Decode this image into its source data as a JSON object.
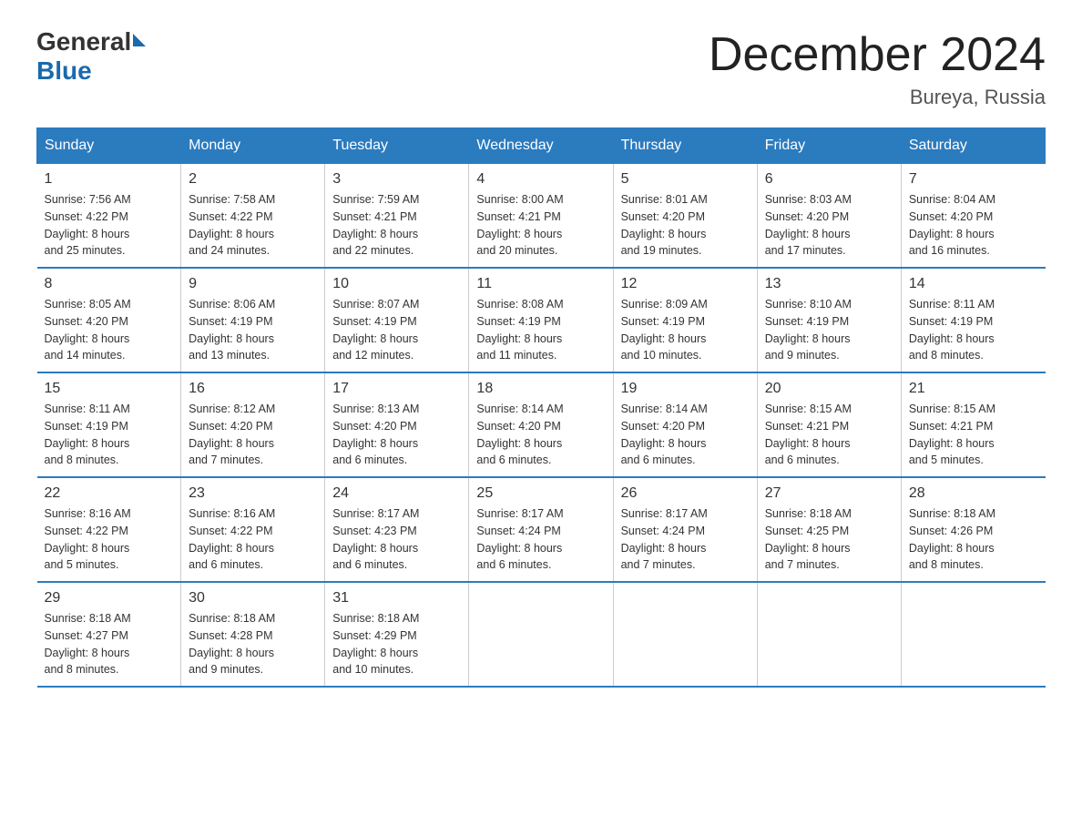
{
  "header": {
    "logo_general": "General",
    "logo_blue": "Blue",
    "month_title": "December 2024",
    "location": "Bureya, Russia"
  },
  "days_of_week": [
    "Sunday",
    "Monday",
    "Tuesday",
    "Wednesday",
    "Thursday",
    "Friday",
    "Saturday"
  ],
  "weeks": [
    [
      {
        "day": "1",
        "sunrise": "7:56 AM",
        "sunset": "4:22 PM",
        "daylight": "8 hours and 25 minutes."
      },
      {
        "day": "2",
        "sunrise": "7:58 AM",
        "sunset": "4:22 PM",
        "daylight": "8 hours and 24 minutes."
      },
      {
        "day": "3",
        "sunrise": "7:59 AM",
        "sunset": "4:21 PM",
        "daylight": "8 hours and 22 minutes."
      },
      {
        "day": "4",
        "sunrise": "8:00 AM",
        "sunset": "4:21 PM",
        "daylight": "8 hours and 20 minutes."
      },
      {
        "day": "5",
        "sunrise": "8:01 AM",
        "sunset": "4:20 PM",
        "daylight": "8 hours and 19 minutes."
      },
      {
        "day": "6",
        "sunrise": "8:03 AM",
        "sunset": "4:20 PM",
        "daylight": "8 hours and 17 minutes."
      },
      {
        "day": "7",
        "sunrise": "8:04 AM",
        "sunset": "4:20 PM",
        "daylight": "8 hours and 16 minutes."
      }
    ],
    [
      {
        "day": "8",
        "sunrise": "8:05 AM",
        "sunset": "4:20 PM",
        "daylight": "8 hours and 14 minutes."
      },
      {
        "day": "9",
        "sunrise": "8:06 AM",
        "sunset": "4:19 PM",
        "daylight": "8 hours and 13 minutes."
      },
      {
        "day": "10",
        "sunrise": "8:07 AM",
        "sunset": "4:19 PM",
        "daylight": "8 hours and 12 minutes."
      },
      {
        "day": "11",
        "sunrise": "8:08 AM",
        "sunset": "4:19 PM",
        "daylight": "8 hours and 11 minutes."
      },
      {
        "day": "12",
        "sunrise": "8:09 AM",
        "sunset": "4:19 PM",
        "daylight": "8 hours and 10 minutes."
      },
      {
        "day": "13",
        "sunrise": "8:10 AM",
        "sunset": "4:19 PM",
        "daylight": "8 hours and 9 minutes."
      },
      {
        "day": "14",
        "sunrise": "8:11 AM",
        "sunset": "4:19 PM",
        "daylight": "8 hours and 8 minutes."
      }
    ],
    [
      {
        "day": "15",
        "sunrise": "8:11 AM",
        "sunset": "4:19 PM",
        "daylight": "8 hours and 8 minutes."
      },
      {
        "day": "16",
        "sunrise": "8:12 AM",
        "sunset": "4:20 PM",
        "daylight": "8 hours and 7 minutes."
      },
      {
        "day": "17",
        "sunrise": "8:13 AM",
        "sunset": "4:20 PM",
        "daylight": "8 hours and 6 minutes."
      },
      {
        "day": "18",
        "sunrise": "8:14 AM",
        "sunset": "4:20 PM",
        "daylight": "8 hours and 6 minutes."
      },
      {
        "day": "19",
        "sunrise": "8:14 AM",
        "sunset": "4:20 PM",
        "daylight": "8 hours and 6 minutes."
      },
      {
        "day": "20",
        "sunrise": "8:15 AM",
        "sunset": "4:21 PM",
        "daylight": "8 hours and 6 minutes."
      },
      {
        "day": "21",
        "sunrise": "8:15 AM",
        "sunset": "4:21 PM",
        "daylight": "8 hours and 5 minutes."
      }
    ],
    [
      {
        "day": "22",
        "sunrise": "8:16 AM",
        "sunset": "4:22 PM",
        "daylight": "8 hours and 5 minutes."
      },
      {
        "day": "23",
        "sunrise": "8:16 AM",
        "sunset": "4:22 PM",
        "daylight": "8 hours and 6 minutes."
      },
      {
        "day": "24",
        "sunrise": "8:17 AM",
        "sunset": "4:23 PM",
        "daylight": "8 hours and 6 minutes."
      },
      {
        "day": "25",
        "sunrise": "8:17 AM",
        "sunset": "4:24 PM",
        "daylight": "8 hours and 6 minutes."
      },
      {
        "day": "26",
        "sunrise": "8:17 AM",
        "sunset": "4:24 PM",
        "daylight": "8 hours and 7 minutes."
      },
      {
        "day": "27",
        "sunrise": "8:18 AM",
        "sunset": "4:25 PM",
        "daylight": "8 hours and 7 minutes."
      },
      {
        "day": "28",
        "sunrise": "8:18 AM",
        "sunset": "4:26 PM",
        "daylight": "8 hours and 8 minutes."
      }
    ],
    [
      {
        "day": "29",
        "sunrise": "8:18 AM",
        "sunset": "4:27 PM",
        "daylight": "8 hours and 8 minutes."
      },
      {
        "day": "30",
        "sunrise": "8:18 AM",
        "sunset": "4:28 PM",
        "daylight": "8 hours and 9 minutes."
      },
      {
        "day": "31",
        "sunrise": "8:18 AM",
        "sunset": "4:29 PM",
        "daylight": "8 hours and 10 minutes."
      },
      null,
      null,
      null,
      null
    ]
  ],
  "labels": {
    "sunrise": "Sunrise:",
    "sunset": "Sunset:",
    "daylight": "Daylight:"
  }
}
